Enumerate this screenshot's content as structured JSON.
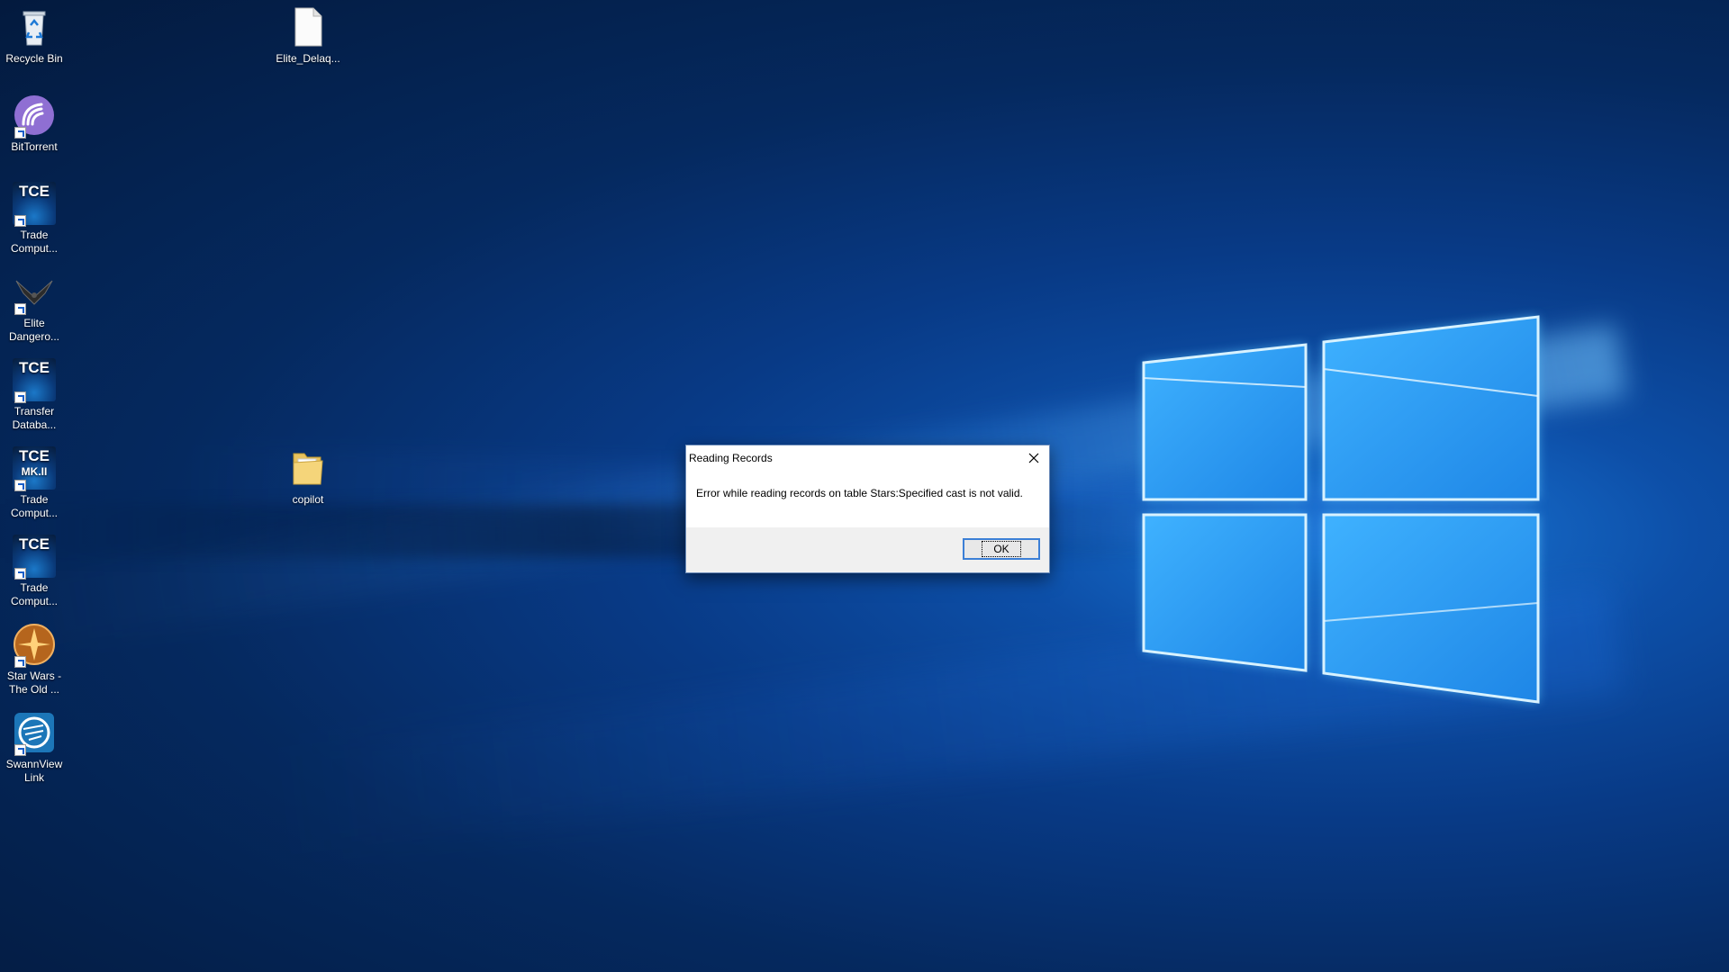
{
  "desktop": {
    "icons": [
      {
        "name": "recycle-bin",
        "label": "Recycle Bin"
      },
      {
        "name": "bittorrent",
        "label": "BitTorrent"
      },
      {
        "name": "trade-computer-1",
        "label": "Trade\nComput..."
      },
      {
        "name": "elite-dangerous",
        "label": "Elite\nDangero..."
      },
      {
        "name": "transfer-database",
        "label": "Transfer\nDataba..."
      },
      {
        "name": "trade-computer-mkii",
        "label": "Trade\nComput..."
      },
      {
        "name": "trade-computer-2",
        "label": "Trade\nComput..."
      },
      {
        "name": "star-wars",
        "label": "Star Wars -\nThe Old ..."
      },
      {
        "name": "swannview-link",
        "label": "SwannView\nLink"
      },
      {
        "name": "elite-delaq-file",
        "label": "Elite_Delaq..."
      },
      {
        "name": "copilot-folder",
        "label": "copilot"
      }
    ],
    "tce_text": "TCE",
    "tce_mkii_text": "MK.II"
  },
  "dialog": {
    "title": "Reading Records",
    "message": "Error while reading records on table Stars:Specified cast is not valid.",
    "ok_label": "OK"
  },
  "colors": {
    "wallpaper_dark": "#031a3e",
    "wallpaper_light": "#1a78d8",
    "button_focus": "#3c7fd6"
  }
}
